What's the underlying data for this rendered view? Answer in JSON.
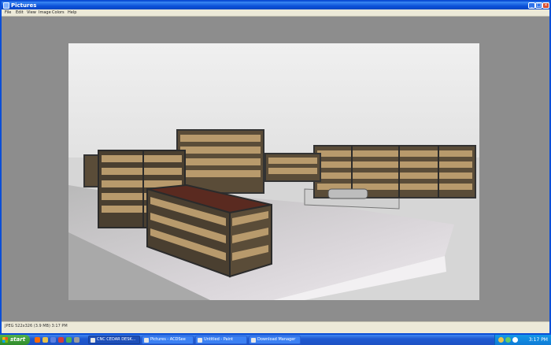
{
  "window": {
    "title": "Pictures",
    "buttons": {
      "minimize": "_",
      "maximize": "□",
      "close": "×"
    }
  },
  "menu": {
    "items": [
      "File",
      "Edit",
      "View",
      "Image",
      "Colors",
      "Help"
    ]
  },
  "status": {
    "text": "JPEG 522x326 (3.9 MB) 3:17 PM"
  },
  "taskbar": {
    "start_label": "start",
    "tasks": [
      {
        "label": "CNC CEDAR DESK..."
      },
      {
        "label": "Pictures - ACDSee"
      },
      {
        "label": "Untitled - Paint"
      },
      {
        "label": "Download Manager"
      }
    ],
    "clock": "3:17 PM"
  },
  "colors": {
    "titlebar": "#0a4fd8",
    "taskbar": "#1f59d1",
    "start": "#2f8a2a",
    "wood": "#b89a6c",
    "floor": "#d8d8d8"
  }
}
